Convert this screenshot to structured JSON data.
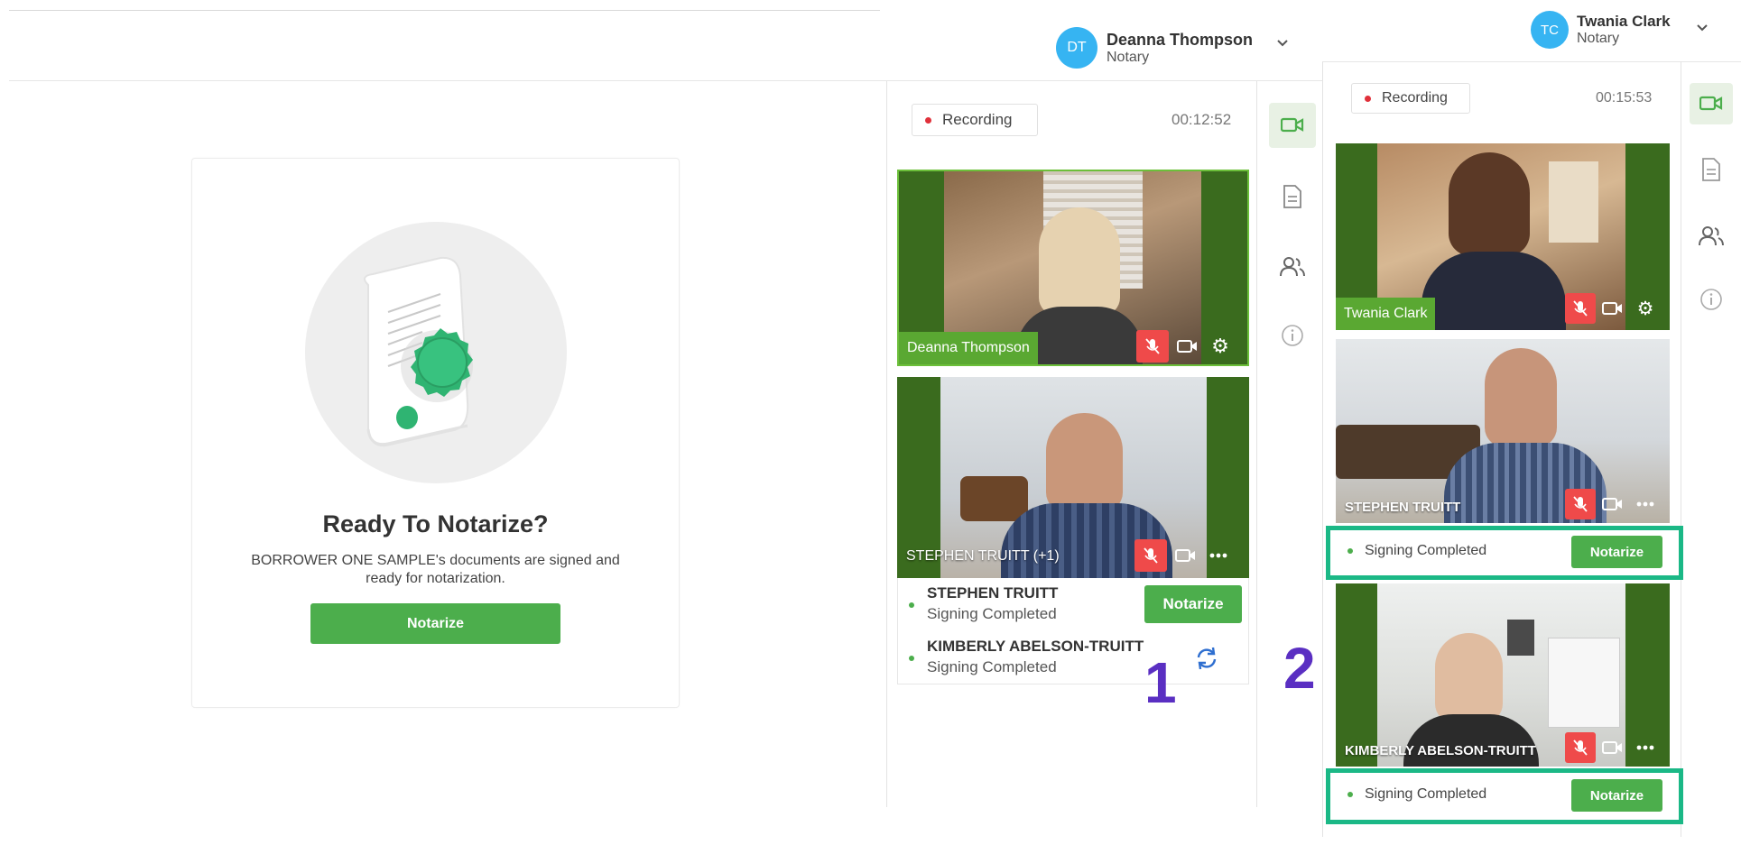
{
  "left_pane": {
    "title": "Ready To Notarize?",
    "description": "BORROWER ONE SAMPLE's documents are signed and ready for notarization.",
    "notarize_label": "Notarize"
  },
  "panel1": {
    "user": {
      "initials": "DT",
      "name": "Deanna Thompson",
      "role": "Notary"
    },
    "recording_label": "Recording",
    "timer": "00:12:52",
    "video1_name": "Deanna Thompson",
    "video2_name": "STEPHEN TRUITT (+1)",
    "participants": [
      {
        "name": "STEPHEN TRUITT",
        "status": "Signing Completed"
      },
      {
        "name": "KIMBERLY ABELSON-TRUITT",
        "status": "Signing Completed"
      }
    ],
    "notarize_label": "Notarize"
  },
  "panel2": {
    "user": {
      "initials": "TC",
      "name": "Twania Clark",
      "role": "Notary"
    },
    "recording_label": "Recording",
    "timer": "00:15:53",
    "video1_name": "Twania Clark",
    "video2_name": "STEPHEN TRUITT",
    "video3_name": "KIMBERLY ABELSON-TRUITT",
    "status1": "Signing Completed",
    "status2": "Signing Completed",
    "notarize_label": "Notarize"
  },
  "markers": {
    "one": "1",
    "two": "2"
  },
  "colors": {
    "accent_green": "#4cae4c",
    "highlight_teal": "#1bb886",
    "avatar_blue": "#36b4f2",
    "mute_red": "#ef4a4a",
    "marker_purple": "#5a2fc2"
  },
  "icons": [
    "chevron-down-icon",
    "video-camera-icon",
    "document-icon",
    "participants-icon",
    "info-icon",
    "microphone-muted-icon",
    "settings-gear-icon",
    "more-options-icon",
    "sync-icon",
    "certificate-seal-illustration"
  ]
}
